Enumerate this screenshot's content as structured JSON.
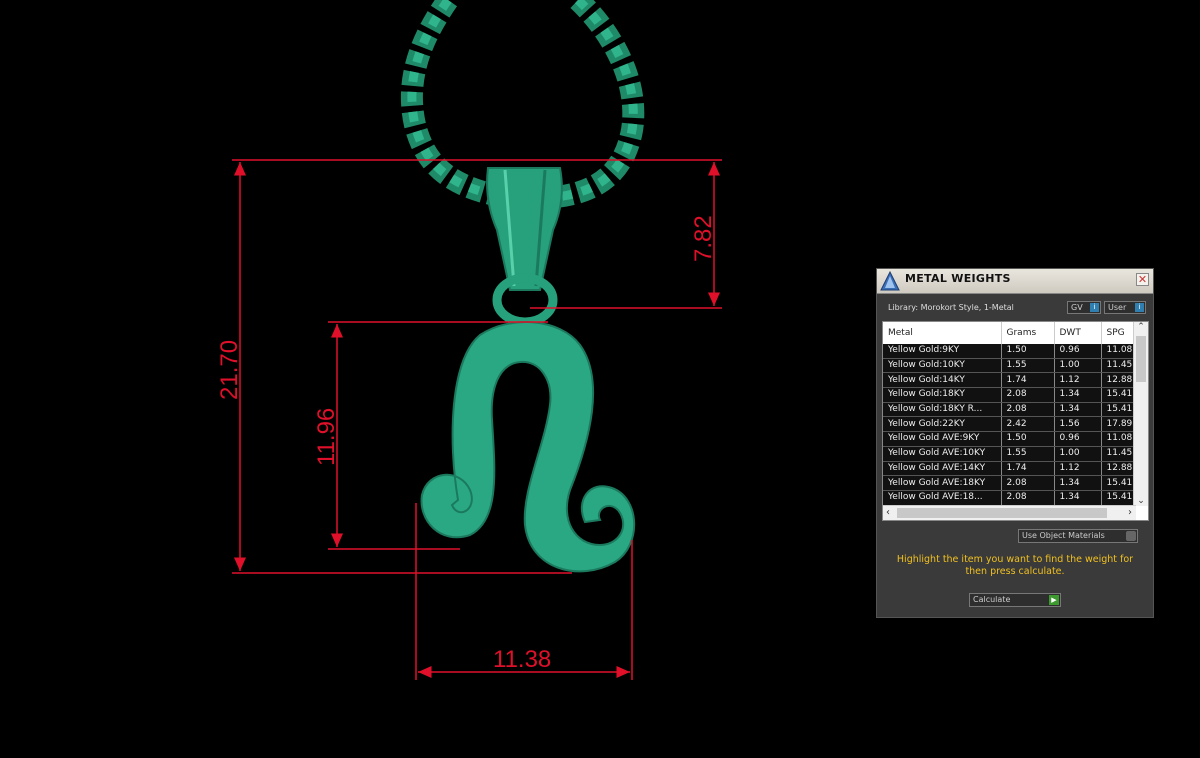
{
  "dimensions": {
    "total_height": "21.70",
    "bail_height": "7.82",
    "pendant_height": "11.96",
    "pendant_width": "11.38"
  },
  "colors": {
    "model": "#2aa883",
    "dimension_lines": "#e0102a",
    "hint_text": "#f0c020"
  },
  "panel": {
    "title": "METAL WEIGHTS",
    "close_icon": "close-icon",
    "library": "Library: Morokort Style, 1-Metal",
    "gv_label": "GV",
    "user_label": "User",
    "columns": [
      "Metal",
      "Grams",
      "DWT",
      "SPG"
    ],
    "rows": [
      [
        "Yellow Gold:9KY",
        "1.50",
        "0.96",
        "11.08"
      ],
      [
        "Yellow Gold:10KY",
        "1.55",
        "1.00",
        "11.45"
      ],
      [
        "Yellow Gold:14KY",
        "1.74",
        "1.12",
        "12.88"
      ],
      [
        "Yellow Gold:18KY",
        "2.08",
        "1.34",
        "15.41"
      ],
      [
        "Yellow Gold:18KY R...",
        "2.08",
        "1.34",
        "15.41"
      ],
      [
        "Yellow Gold:22KY",
        "2.42",
        "1.56",
        "17.89"
      ],
      [
        "Yellow Gold AVE:9KY",
        "1.50",
        "0.96",
        "11.08"
      ],
      [
        "Yellow Gold AVE:10KY",
        "1.55",
        "1.00",
        "11.45"
      ],
      [
        "Yellow Gold AVE:14KY",
        "1.74",
        "1.12",
        "12.88"
      ],
      [
        "Yellow Gold AVE:18KY",
        "2.08",
        "1.34",
        "15.41"
      ],
      [
        "Yellow Gold AVE:18...",
        "2.08",
        "1.34",
        "15.41"
      ]
    ],
    "use_object_materials": "Use Object Materials",
    "hint": "Highlight the item you want to find the weight for then press calculate.",
    "calculate": "Calculate"
  }
}
